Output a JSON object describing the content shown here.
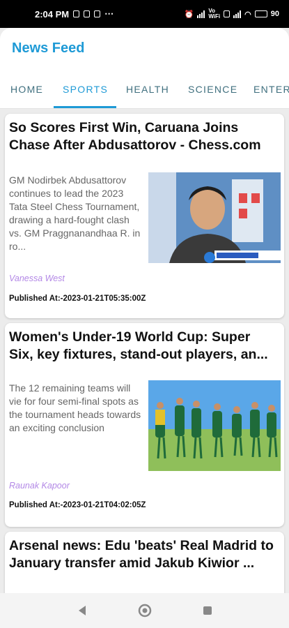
{
  "status_bar": {
    "time": "2:04 PM",
    "battery": "90"
  },
  "app": {
    "title": "News Feed"
  },
  "tabs": [
    {
      "label": "HOME"
    },
    {
      "label": "SPORTS"
    },
    {
      "label": "HEALTH"
    },
    {
      "label": "SCIENCE"
    },
    {
      "label": "ENTER"
    }
  ],
  "active_tab": "SPORTS",
  "articles": [
    {
      "title": "So Scores First Win, Caruana Joins Chase After Abdusattorov - Chess.com",
      "description": "GM Nodirbek Abdusattorov continues to lead the 2023 Tata Steel Chess Tournament, drawing a hard-fought clash vs. GM Praggnanandhaa R. in ro...",
      "author": "Vanessa West",
      "published": "Published At:-2023-01-21T05:35:00Z",
      "image_desc": "chess player smiling"
    },
    {
      "title": "Women's Under-19 World Cup: Super Six, key fixtures, stand-out players, an...",
      "description": "The 12 remaining teams will vie for four semi-final spots as the tournament heads towards an exciting conclusion",
      "author": "Raunak Kapoor",
      "published": "Published At:-2023-01-21T04:02:05Z",
      "image_desc": "cricket team celebrating"
    },
    {
      "title": "Arsenal news: Edu 'beats' Real Madrid to January transfer amid Jakub Kiwior ..."
    }
  ],
  "colors": {
    "accent": "#1e9ad6",
    "tab_inactive": "#3f6f7e",
    "author": "#b388e6",
    "background": "#ececec"
  },
  "icons": {
    "nav_back": "back-triangle-icon",
    "nav_home": "home-circle-icon",
    "nav_recents": "recents-square-icon"
  }
}
